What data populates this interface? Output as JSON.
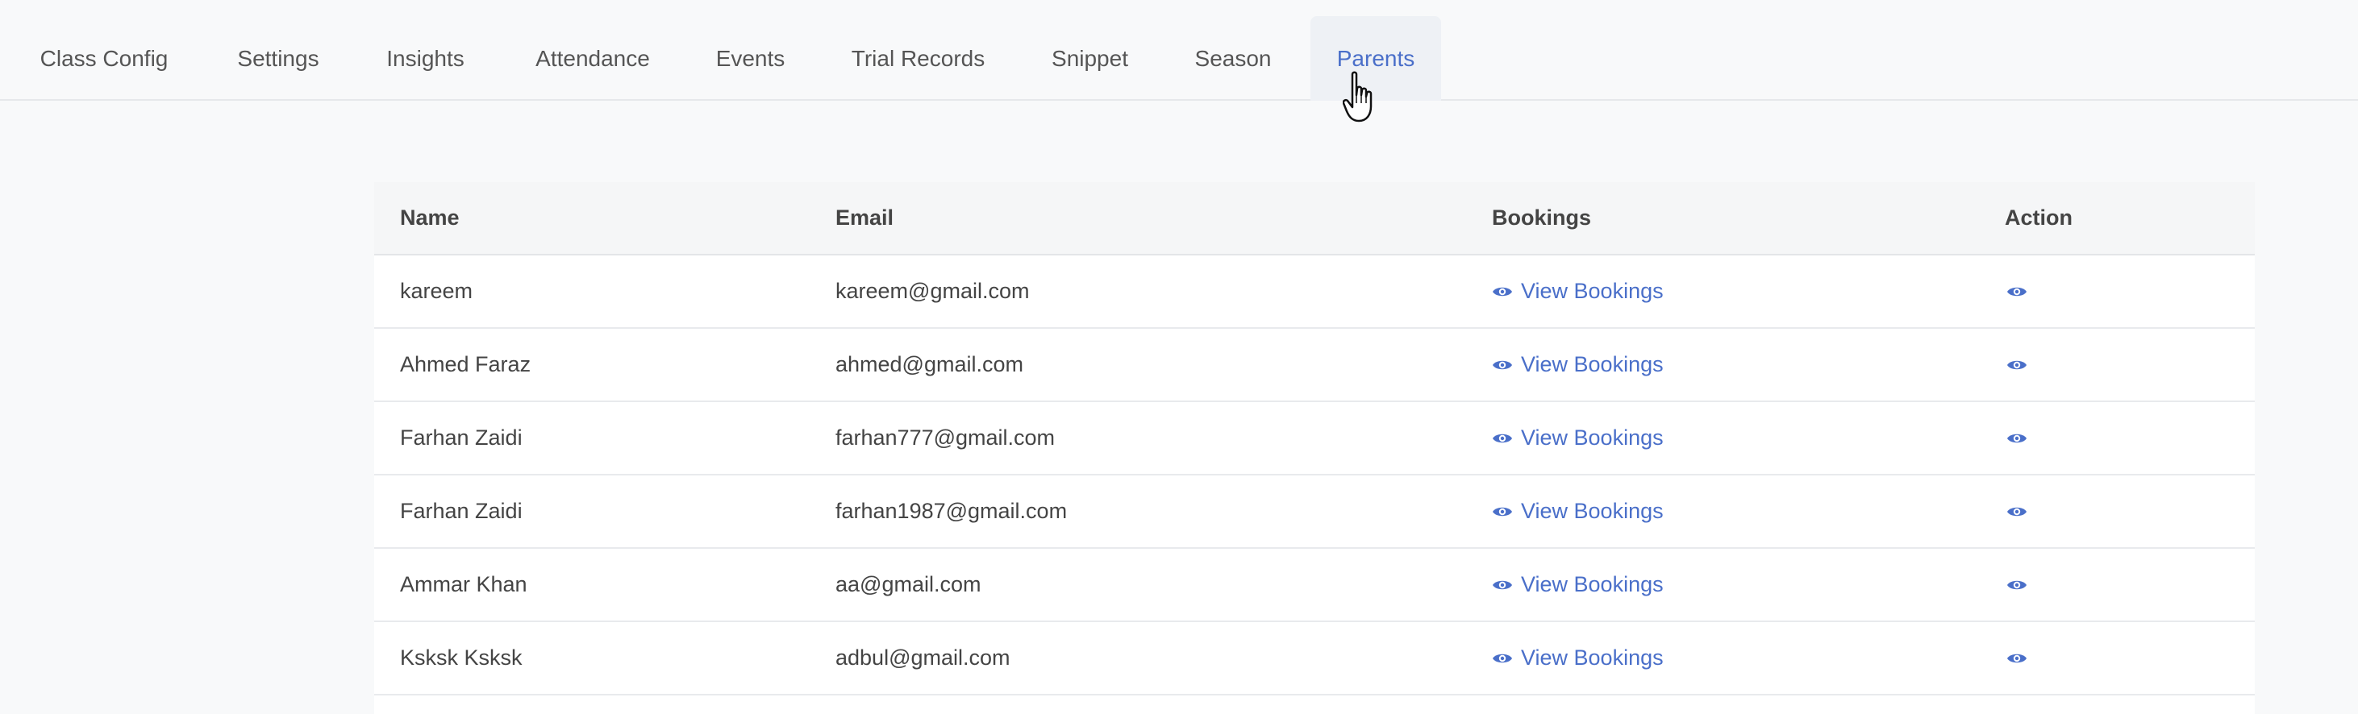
{
  "tabs": [
    {
      "label": "Class Config"
    },
    {
      "label": "Settings"
    },
    {
      "label": "Insights"
    },
    {
      "label": "Attendance"
    },
    {
      "label": "Events"
    },
    {
      "label": "Trial Records"
    },
    {
      "label": "Snippet"
    },
    {
      "label": "Season"
    },
    {
      "label": "Parents"
    }
  ],
  "active_tab": "Parents",
  "table": {
    "headers": {
      "name": "Name",
      "email": "Email",
      "bookings": "Bookings",
      "action": "Action"
    },
    "rows": [
      {
        "name": "kareem",
        "email": "kareem@gmail.com",
        "bookings": "View Bookings"
      },
      {
        "name": "Ahmed Faraz",
        "email": "ahmed@gmail.com",
        "bookings": "View Bookings"
      },
      {
        "name": "Farhan Zaidi",
        "email": "farhan777@gmail.com",
        "bookings": "View Bookings"
      },
      {
        "name": "Farhan Zaidi",
        "email": "farhan1987@gmail.com",
        "bookings": "View Bookings"
      },
      {
        "name": "Ammar Khan",
        "email": "aa@gmail.com",
        "bookings": "View Bookings"
      },
      {
        "name": "Ksksk Ksksk",
        "email": "adbul@gmail.com",
        "bookings": "View Bookings"
      }
    ]
  },
  "icons": {
    "bookings": "eye-icon",
    "action": "eye-icon",
    "cursor": "hand-pointer-icon"
  },
  "colors": {
    "accent": "#4a6fc9",
    "active_tab_bg": "#eef1f5",
    "header_bg": "#f5f6f7"
  }
}
